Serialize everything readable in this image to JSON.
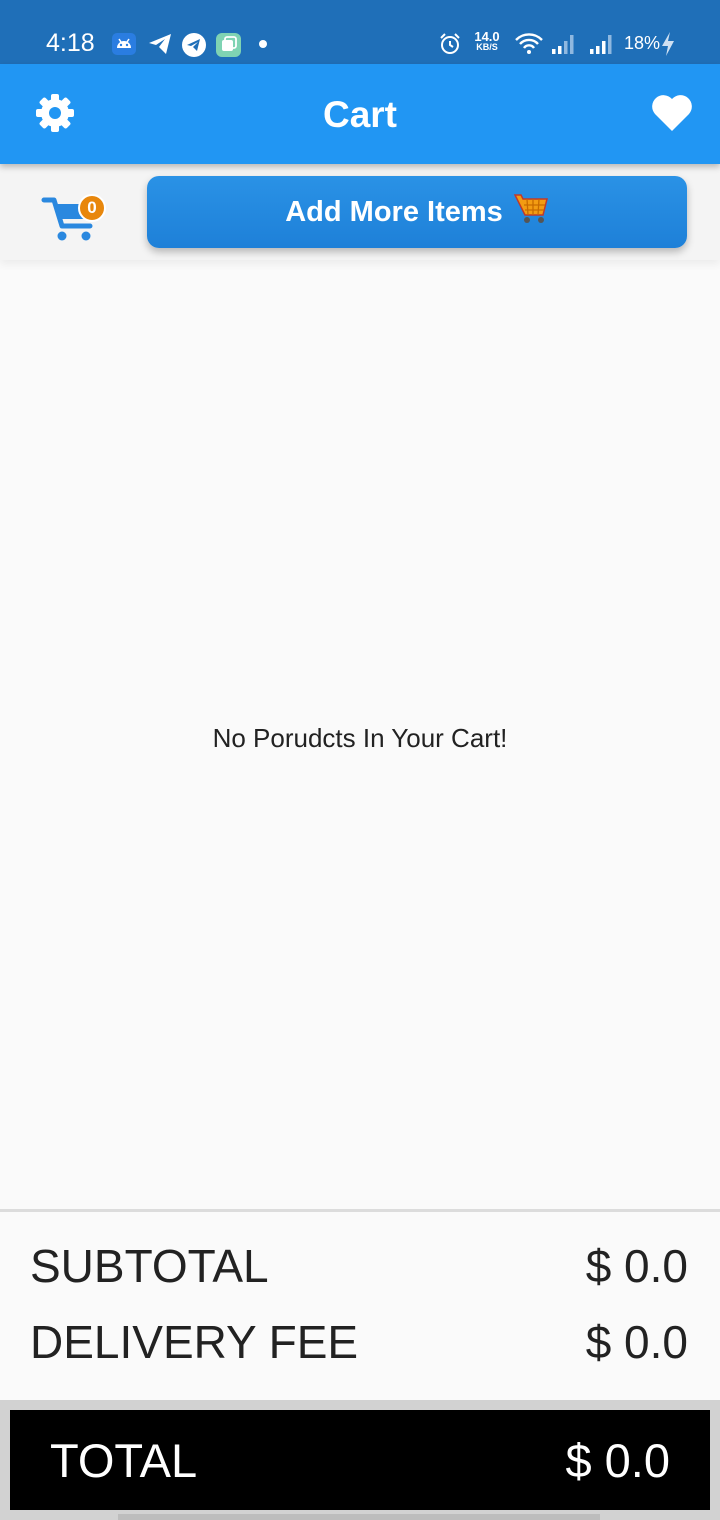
{
  "status_bar": {
    "time": "4:18",
    "speed_value": "14.0",
    "speed_unit": "KB/S",
    "battery": "18%",
    "notification_icons": [
      "android-icon",
      "send-icon",
      "telegram-icon",
      "app-switch-icon"
    ]
  },
  "app_bar": {
    "title": "Cart"
  },
  "cart": {
    "badge_count": "0",
    "add_more_label": "Add More Items",
    "empty_message": "No Porudcts In Your Cart!"
  },
  "summary": {
    "subtotal_label": "SUBTOTAL",
    "subtotal_value": "$ 0.0",
    "delivery_label": "DELIVERY FEE",
    "delivery_value": "$ 0.0",
    "total_label": "TOTAL",
    "total_value": "$ 0.0"
  },
  "colors": {
    "status_bar": "#1f6fb8",
    "app_bar": "#2196f3",
    "button": "#1e88e5",
    "badge": "#e8870c",
    "total_bar": "#000000"
  }
}
